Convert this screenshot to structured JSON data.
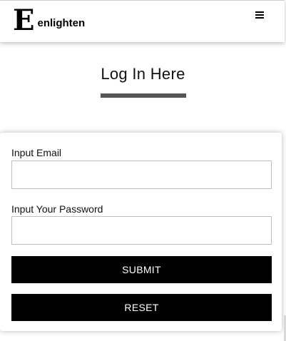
{
  "header": {
    "logo_mark": "E",
    "brand": "enlighten",
    "menu_icon": "hamburger-menu-icon"
  },
  "hero": {
    "title": "Log In Here"
  },
  "form": {
    "email_label": "Input Email",
    "email_value": "",
    "email_placeholder": "",
    "password_label": "Input Your Password",
    "password_value": "",
    "password_placeholder": "",
    "submit_label": "SUBMIT",
    "reset_label": "RESET"
  },
  "colors": {
    "button_bg": "#000000",
    "button_text": "#ffffff",
    "underline": "#555555"
  }
}
